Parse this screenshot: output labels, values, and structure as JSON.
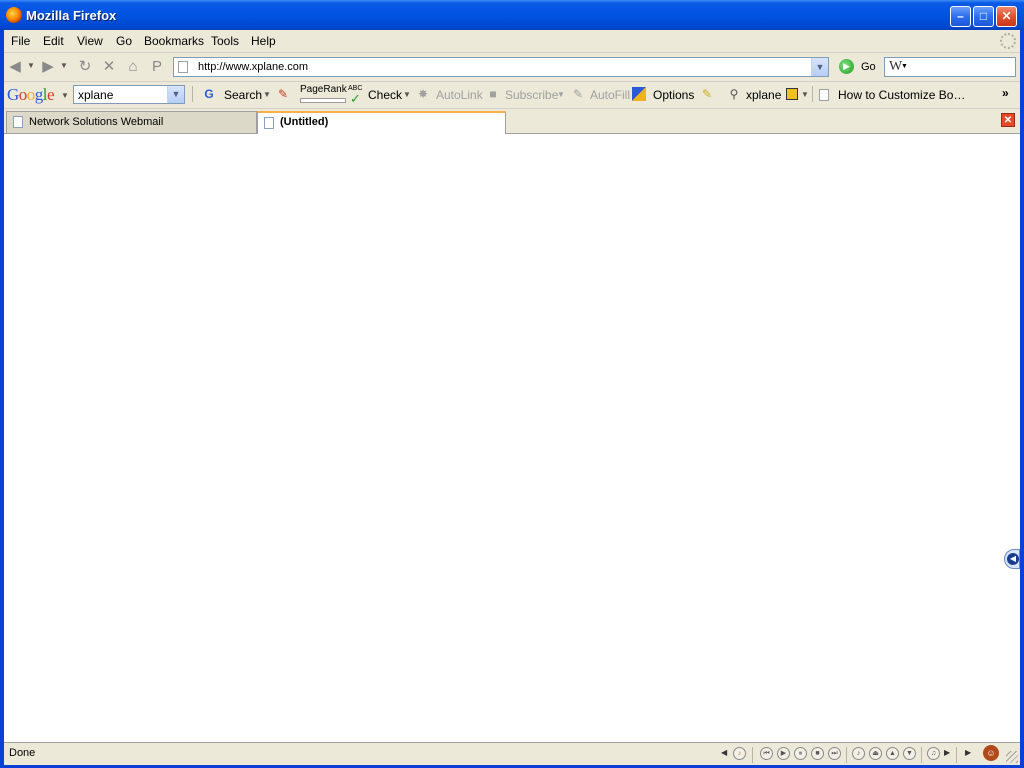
{
  "window": {
    "title": "Mozilla Firefox",
    "minimize_glyph": "–",
    "maximize_glyph": "□",
    "close_glyph": "✕"
  },
  "menu": {
    "items": [
      {
        "label": "File",
        "accel": "F"
      },
      {
        "label": "Edit",
        "accel": "E"
      },
      {
        "label": "View",
        "accel": "V"
      },
      {
        "label": "Go",
        "accel": "G"
      },
      {
        "label": "Bookmarks",
        "accel": "B"
      },
      {
        "label": "Tools",
        "accel": "T"
      },
      {
        "label": "Help",
        "accel": "H"
      }
    ]
  },
  "nav": {
    "url": "http://www.xplane.com",
    "go_label": "Go",
    "wiki_glyph": "W"
  },
  "google_toolbar": {
    "logo": "Google",
    "search_value": "xplane",
    "search_label": "Search",
    "pagerank_label": "PageRank",
    "check_abc": "ABC",
    "check_label": "Check",
    "autolink_label": "AutoLink",
    "subscribe_label": "Subscribe",
    "autofill_label": "AutoFill",
    "options_label": "Options",
    "xplane_label": "xplane",
    "bookmark_label": "How to Customize Bo…",
    "overflow": "»"
  },
  "tabs": [
    {
      "label": "Network Solutions Webmail",
      "selected": false
    },
    {
      "label": "(Untitled)",
      "selected": true
    }
  ],
  "status": {
    "text": "Done"
  },
  "colors": {
    "titlebar": "#0053e1",
    "chrome": "#ece9d8",
    "tab_highlight": "#f5b04a",
    "close_red": "#e24a2a"
  }
}
